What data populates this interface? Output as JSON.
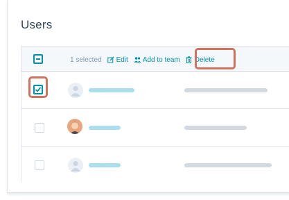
{
  "page": {
    "title": "Users"
  },
  "toolbar": {
    "selected_text": "1 selected",
    "edit_label": "Edit",
    "add_to_team_label": "Add to team",
    "delete_label": "Delete"
  },
  "rows": [
    {
      "checked": true,
      "avatar": "default-avatar"
    },
    {
      "checked": false,
      "avatar": "photo-avatar"
    },
    {
      "checked": false,
      "avatar": "default-avatar"
    }
  ],
  "colors": {
    "accent": "#0091ae",
    "highlight": "#d1715e",
    "text": "#33475b",
    "muted": "#7c98b6"
  },
  "icons": {
    "edit": "pencil-icon",
    "add_to_team": "users-icon",
    "delete": "trash-icon",
    "bulk_select": "minus-checkbox-icon",
    "row_select": "checkbox-icon"
  }
}
